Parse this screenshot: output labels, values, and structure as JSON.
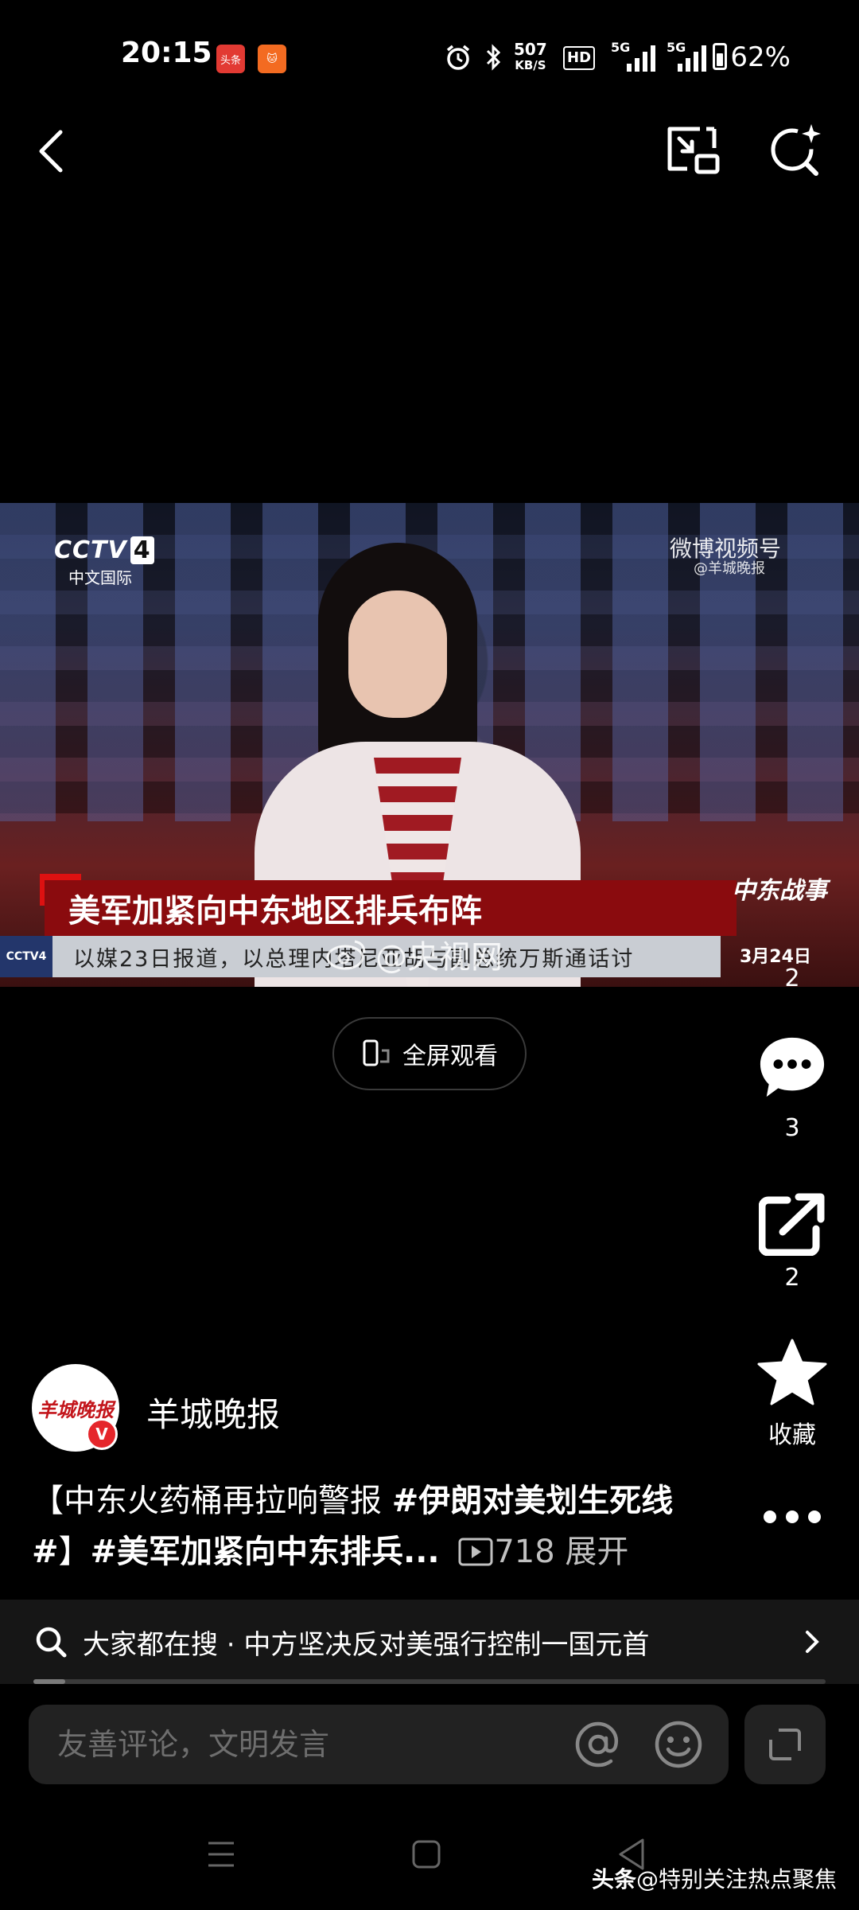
{
  "status_bar": {
    "time": "20:15",
    "app_badges": [
      "头条",
      "🐱"
    ],
    "net_speed_value": "507",
    "net_speed_unit": "KB/S",
    "hd_label": "HD",
    "signal1_label": "5G",
    "signal2_label": "5G",
    "battery": "62%",
    "battery_level": 0.62
  },
  "video": {
    "channel_logo": "CCTV",
    "channel_number": "4",
    "channel_sub": "中文国际",
    "watermark_top": "微博视频号",
    "watermark_top_sub": "@羊城晚报",
    "headline": "美军加紧向中东地区排兵布阵",
    "ticker_logo": "CCTV4",
    "ticker": "以媒23日报道，以总理内塔尼亚胡与副总统万斯通话讨",
    "corner_logo": "中东战事",
    "corner_date": "3月24日",
    "center_watermark": "@央视网"
  },
  "fullscreen": {
    "label": "全屏观看"
  },
  "actions": {
    "like_count": "2",
    "comment_count": "3",
    "share_count": "2",
    "favorite_label": "收藏"
  },
  "author": {
    "avatar_text": "羊城晚报",
    "verified_mark": "V",
    "name": "羊城晚报"
  },
  "caption": {
    "prefix": "【中东火药桶再拉响警报 ",
    "tag1": "#伊朗对美划生死线#",
    "mid": "】",
    "tag2": "#美军加紧向中东排兵...",
    "play_count": "718",
    "expand": "展开"
  },
  "search": {
    "text": "大家都在搜 · 中方坚决反对美强行控制一国元首",
    "progress": 0.04
  },
  "comment": {
    "placeholder": "友善评论，文明发言"
  },
  "watermark": {
    "brand": "头条",
    "handle": "@特别关注热点聚焦"
  }
}
